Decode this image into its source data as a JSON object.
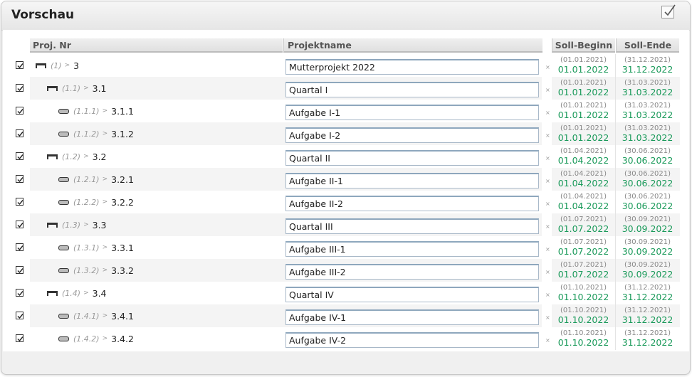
{
  "dialog": {
    "title": "Vorschau"
  },
  "columns": {
    "proj_nr": "Proj. Nr",
    "projektname": "Projektname",
    "soll_beginn": "Soll-Beginn",
    "soll_ende": "Soll-Ende"
  },
  "icons": {
    "folder": "summary-bar-icon",
    "task": "task-bar-icon"
  },
  "colors": {
    "current_date": "#1a9a5a",
    "original_date": "#888888"
  },
  "rows": [
    {
      "checked": true,
      "level": 0,
      "type": "folder",
      "index": "(1)",
      "nr": "3",
      "name": "Mutterprojekt 2022",
      "start_orig": "(01.01.2021)",
      "start": "01.01.2022",
      "end_orig": "(31.12.2021)",
      "end": "31.12.2022"
    },
    {
      "checked": true,
      "level": 1,
      "type": "folder",
      "index": "(1.1)",
      "nr": "3.1",
      "name": "Quartal I",
      "start_orig": "(01.01.2021)",
      "start": "01.01.2022",
      "end_orig": "(31.03.2021)",
      "end": "31.03.2022"
    },
    {
      "checked": true,
      "level": 2,
      "type": "task",
      "index": "(1.1.1)",
      "nr": "3.1.1",
      "name": "Aufgabe I-1",
      "start_orig": "(01.01.2021)",
      "start": "01.01.2022",
      "end_orig": "(31.03.2021)",
      "end": "31.03.2022"
    },
    {
      "checked": true,
      "level": 2,
      "type": "task",
      "index": "(1.1.2)",
      "nr": "3.1.2",
      "name": "Aufgabe I-2",
      "start_orig": "(01.01.2021)",
      "start": "01.01.2022",
      "end_orig": "(31.03.2021)",
      "end": "31.03.2022"
    },
    {
      "checked": true,
      "level": 1,
      "type": "folder",
      "index": "(1.2)",
      "nr": "3.2",
      "name": "Quartal II",
      "start_orig": "(01.04.2021)",
      "start": "01.04.2022",
      "end_orig": "(30.06.2021)",
      "end": "30.06.2022"
    },
    {
      "checked": true,
      "level": 2,
      "type": "task",
      "index": "(1.2.1)",
      "nr": "3.2.1",
      "name": "Aufgabe II-1",
      "start_orig": "(01.04.2021)",
      "start": "01.04.2022",
      "end_orig": "(30.06.2021)",
      "end": "30.06.2022"
    },
    {
      "checked": true,
      "level": 2,
      "type": "task",
      "index": "(1.2.2)",
      "nr": "3.2.2",
      "name": "Aufgabe II-2",
      "start_orig": "(01.04.2021)",
      "start": "01.04.2022",
      "end_orig": "(30.06.2021)",
      "end": "30.06.2022"
    },
    {
      "checked": true,
      "level": 1,
      "type": "folder",
      "index": "(1.3)",
      "nr": "3.3",
      "name": "Quartal III",
      "start_orig": "(01.07.2021)",
      "start": "01.07.2022",
      "end_orig": "(30.09.2021)",
      "end": "30.09.2022"
    },
    {
      "checked": true,
      "level": 2,
      "type": "task",
      "index": "(1.3.1)",
      "nr": "3.3.1",
      "name": "Aufgabe III-1",
      "start_orig": "(01.07.2021)",
      "start": "01.07.2022",
      "end_orig": "(30.09.2021)",
      "end": "30.09.2022"
    },
    {
      "checked": true,
      "level": 2,
      "type": "task",
      "index": "(1.3.2)",
      "nr": "3.3.2",
      "name": "Aufgabe III-2",
      "start_orig": "(01.07.2021)",
      "start": "01.07.2022",
      "end_orig": "(30.09.2021)",
      "end": "30.09.2022"
    },
    {
      "checked": true,
      "level": 1,
      "type": "folder",
      "index": "(1.4)",
      "nr": "3.4",
      "name": "Quartal IV",
      "start_orig": "(01.10.2021)",
      "start": "01.10.2022",
      "end_orig": "(31.12.2021)",
      "end": "31.12.2022"
    },
    {
      "checked": true,
      "level": 2,
      "type": "task",
      "index": "(1.4.1)",
      "nr": "3.4.1",
      "name": "Aufgabe IV-1",
      "start_orig": "(01.10.2021)",
      "start": "01.10.2022",
      "end_orig": "(31.12.2021)",
      "end": "31.12.2022"
    },
    {
      "checked": true,
      "level": 2,
      "type": "task",
      "index": "(1.4.2)",
      "nr": "3.4.2",
      "name": "Aufgabe IV-2",
      "start_orig": "(01.10.2021)",
      "start": "01.10.2022",
      "end_orig": "(31.12.2021)",
      "end": "31.12.2022"
    }
  ]
}
